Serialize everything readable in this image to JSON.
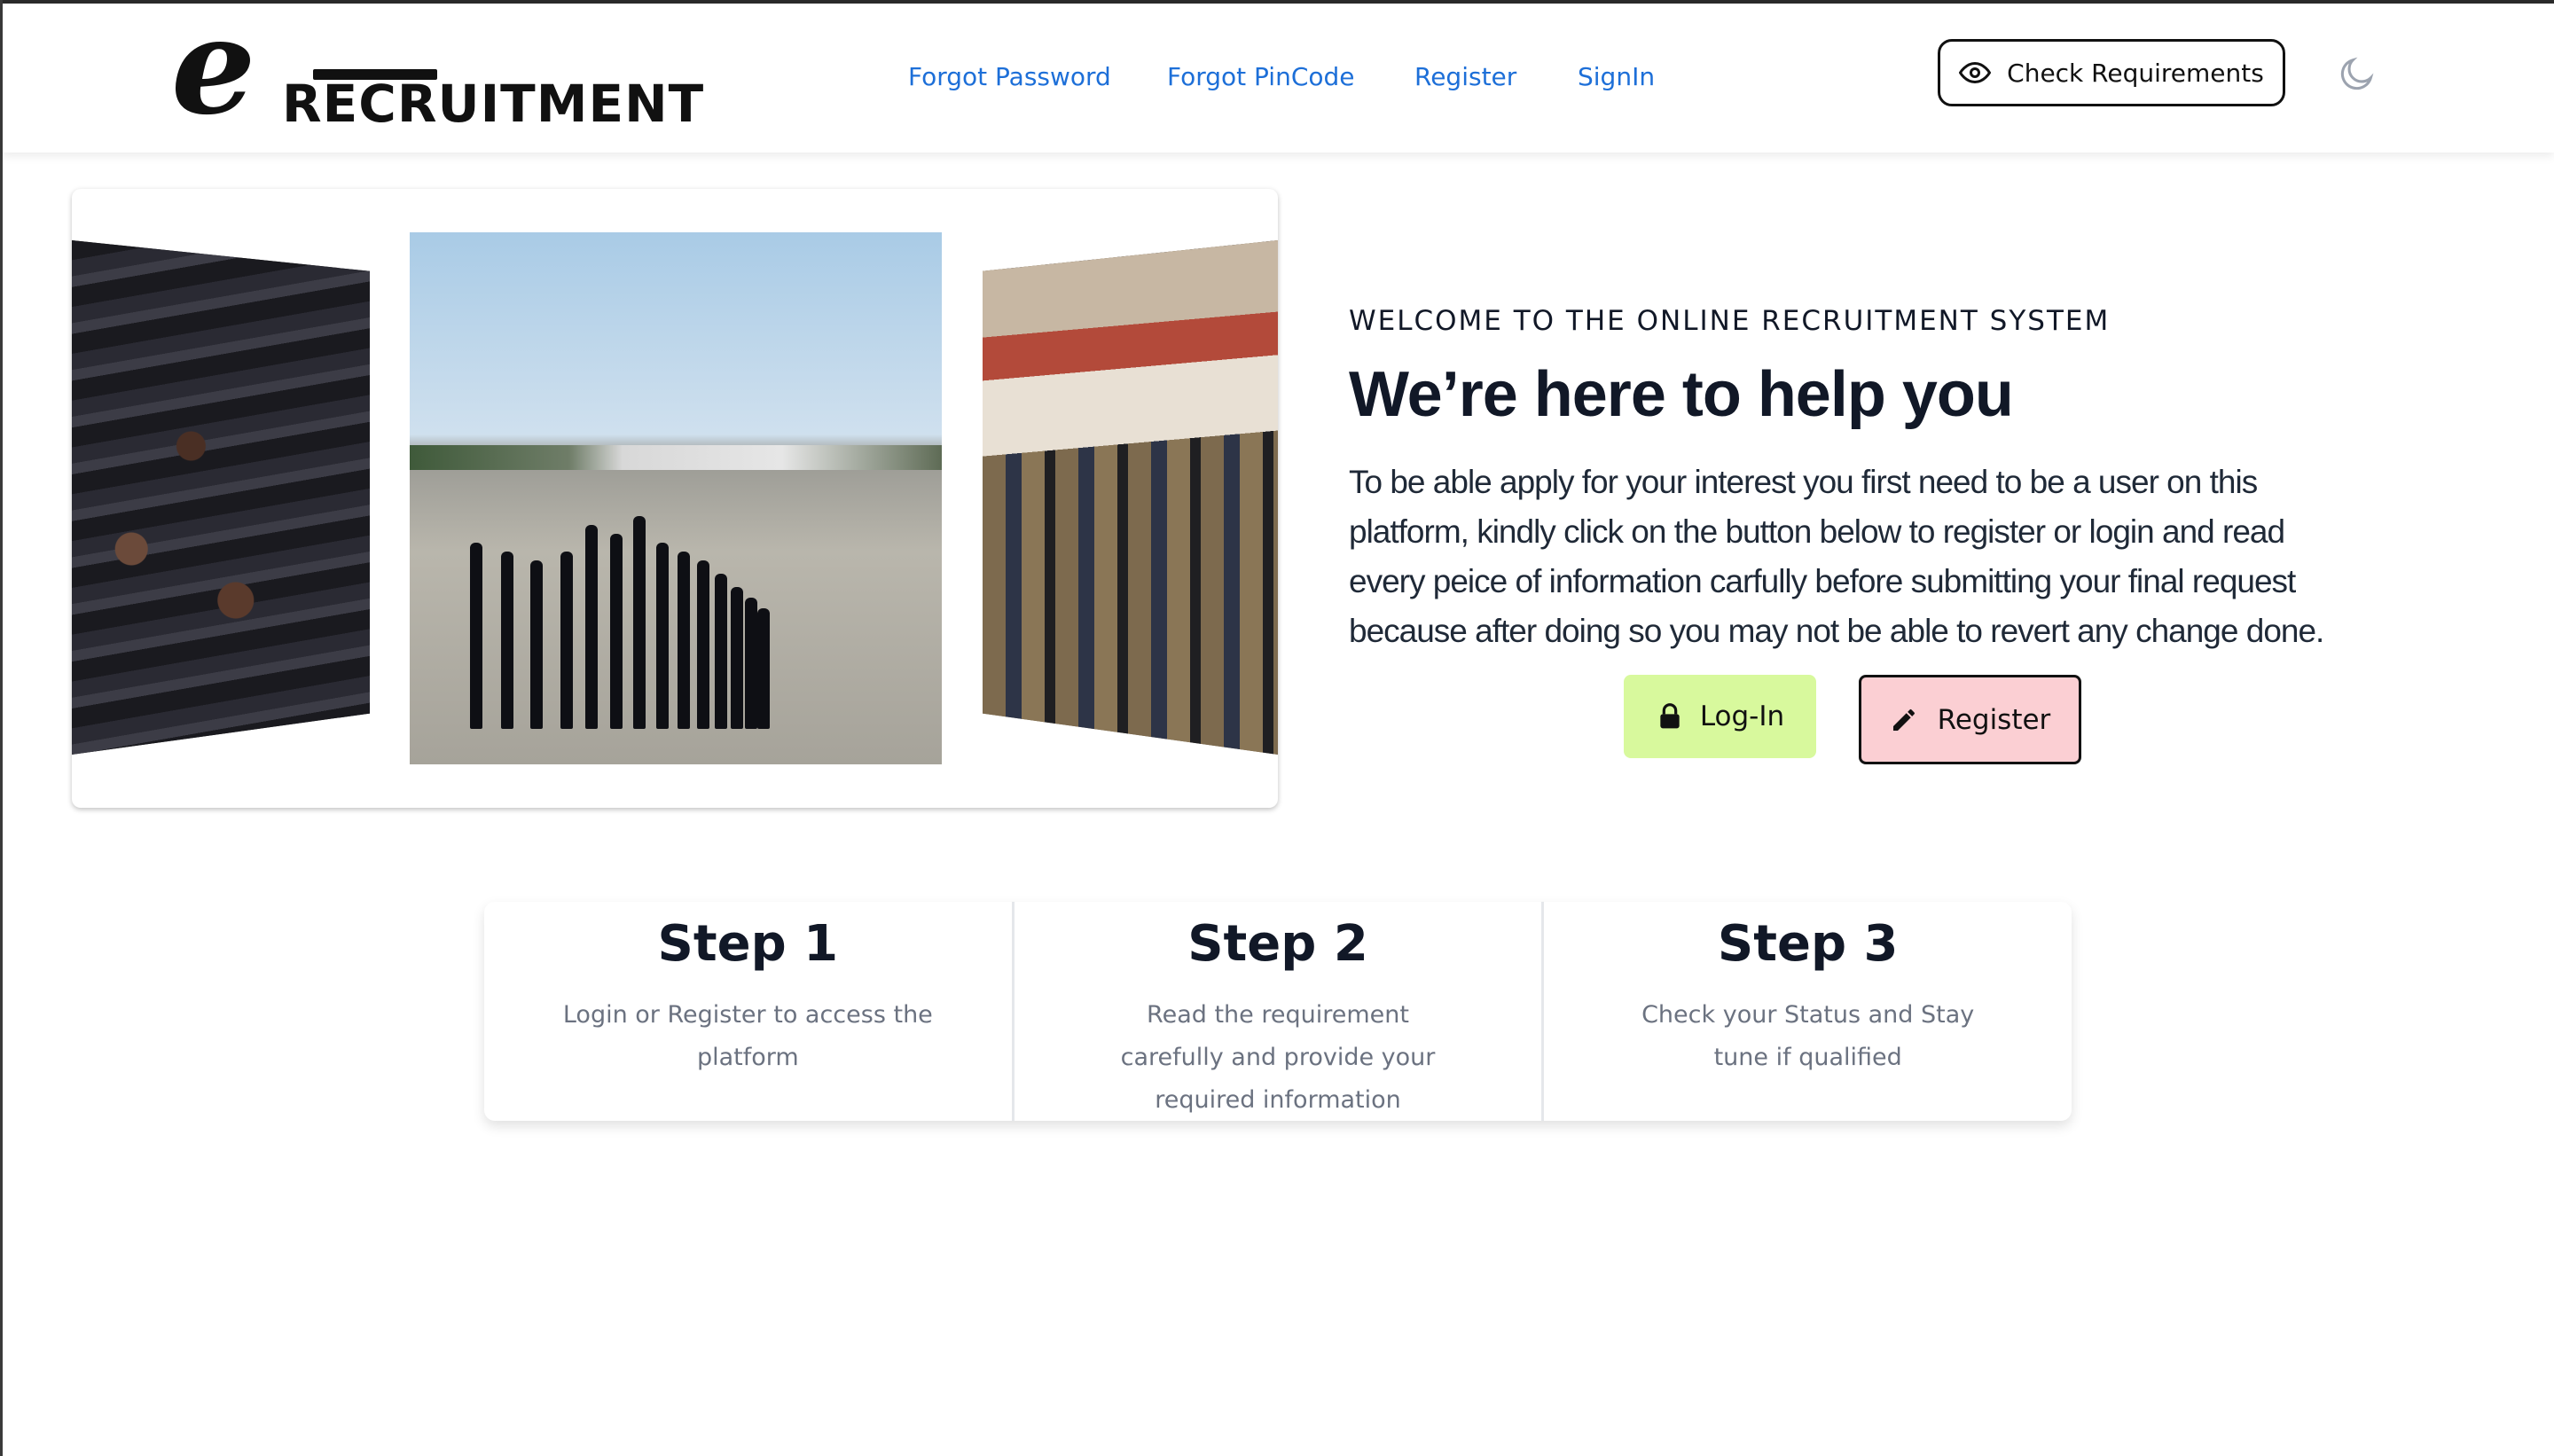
{
  "brand": {
    "logo_letter": "e",
    "logo_word": "RECRUITMENT"
  },
  "nav": {
    "links": [
      {
        "label": "Forgot Password"
      },
      {
        "label": "Forgot PinCode"
      },
      {
        "label": "Register"
      },
      {
        "label": "SignIn"
      }
    ],
    "check_requirements_label": "Check Requirements",
    "eye_icon": "eye-icon",
    "theme_toggle_icon": "moon-icon",
    "link_color": "#1d6fd8"
  },
  "carousel": {
    "slides": [
      {
        "icon": "photo-recruits-seated"
      },
      {
        "icon": "photo-parade-line"
      },
      {
        "icon": "photo-k9-unit"
      }
    ]
  },
  "hero": {
    "eyebrow": "WELCOME TO THE ONLINE RECRUITMENT SYSTEM",
    "headline": "We’re here to help you",
    "body": "To be able apply for your interest you first need to be a user on this platform, kindly click on the button below to register or login and read every peice of information carfully before submitting your final request because after doing so you may not be able to revert any change done.",
    "login_label": "Log-In",
    "register_label": "Register",
    "login_color": "#d8f99d",
    "register_color": "#fbcfd3"
  },
  "steps": [
    {
      "title": "Step 1",
      "description": "Login or Register to access the platform"
    },
    {
      "title": "Step 2",
      "description": "Read the requirement carefully and provide your required information"
    },
    {
      "title": "Step 3",
      "description": "Check your Status and Stay tune if qualified"
    }
  ]
}
